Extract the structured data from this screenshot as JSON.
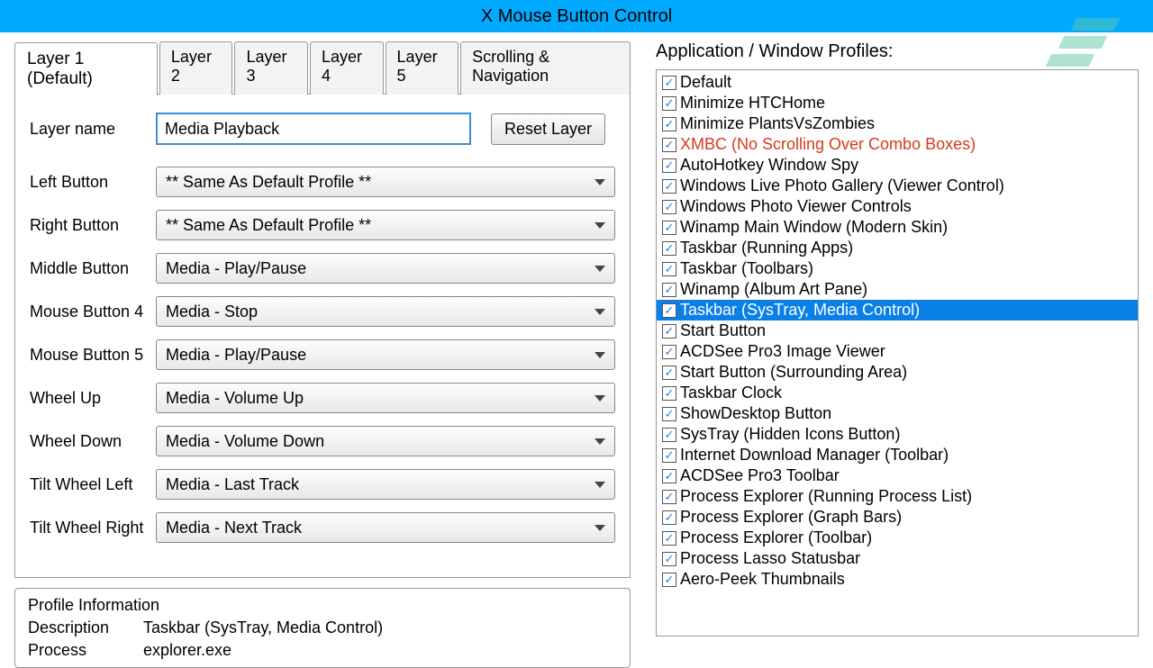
{
  "title": "X Mouse Button Control",
  "tabs": [
    "Layer 1 (Default)",
    "Layer 2",
    "Layer 3",
    "Layer 4",
    "Layer 5",
    "Scrolling & Navigation"
  ],
  "active_tab": 0,
  "layer": {
    "name_label": "Layer name",
    "name_value": "Media Playback",
    "reset_label": "Reset Layer"
  },
  "bindings": [
    {
      "label": "Left Button",
      "value": "** Same As Default Profile **"
    },
    {
      "label": "Right Button",
      "value": "** Same As Default Profile **"
    },
    {
      "label": "Middle Button",
      "value": "Media - Play/Pause"
    },
    {
      "label": "Mouse Button 4",
      "value": "Media - Stop"
    },
    {
      "label": "Mouse Button 5",
      "value": "Media - Play/Pause"
    },
    {
      "label": "Wheel Up",
      "value": "Media - Volume Up"
    },
    {
      "label": "Wheel Down",
      "value": "Media - Volume Down"
    },
    {
      "label": "Tilt Wheel Left",
      "value": "Media - Last Track"
    },
    {
      "label": "Tilt Wheel Right",
      "value": "Media - Next Track"
    }
  ],
  "profile_info": {
    "title": "Profile Information",
    "description_label": "Description",
    "description_value": "Taskbar (SysTray, Media Control)",
    "process_label": "Process",
    "process_value": "explorer.exe"
  },
  "profiles_title": "Application / Window Profiles:",
  "profiles": [
    {
      "name": "Default",
      "checked": true
    },
    {
      "name": "Minimize HTCHome",
      "checked": true
    },
    {
      "name": "Minimize PlantsVsZombies",
      "checked": true
    },
    {
      "name": "XMBC (No Scrolling Over Combo Boxes)",
      "checked": true,
      "highlight": true
    },
    {
      "name": "AutoHotkey Window Spy",
      "checked": true
    },
    {
      "name": "Windows Live Photo Gallery (Viewer Control)",
      "checked": true
    },
    {
      "name": "Windows Photo Viewer Controls",
      "checked": true
    },
    {
      "name": "Winamp Main Window (Modern Skin)",
      "checked": true
    },
    {
      "name": "Taskbar (Running Apps)",
      "checked": true
    },
    {
      "name": "Taskbar (Toolbars)",
      "checked": true
    },
    {
      "name": "Winamp (Album Art Pane)",
      "checked": true
    },
    {
      "name": "Taskbar (SysTray, Media Control)",
      "checked": true,
      "selected": true
    },
    {
      "name": "Start Button",
      "checked": true
    },
    {
      "name": "ACDSee Pro3 Image Viewer",
      "checked": true
    },
    {
      "name": "Start Button (Surrounding Area)",
      "checked": true
    },
    {
      "name": "Taskbar Clock",
      "checked": true
    },
    {
      "name": "ShowDesktop Button",
      "checked": true
    },
    {
      "name": "SysTray (Hidden Icons Button)",
      "checked": true
    },
    {
      "name": "Internet Download Manager (Toolbar)",
      "checked": true
    },
    {
      "name": "ACDSee Pro3 Toolbar",
      "checked": true
    },
    {
      "name": "Process Explorer (Running Process List)",
      "checked": true
    },
    {
      "name": "Process Explorer (Graph Bars)",
      "checked": true
    },
    {
      "name": "Process Explorer (Toolbar)",
      "checked": true
    },
    {
      "name": "Process Lasso Statusbar",
      "checked": true
    },
    {
      "name": "Aero-Peek Thumbnails",
      "checked": true
    }
  ]
}
